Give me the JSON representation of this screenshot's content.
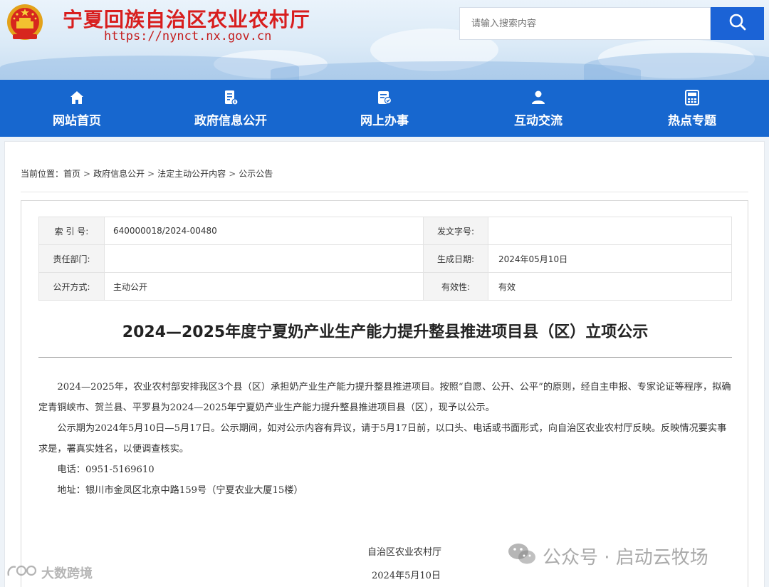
{
  "header": {
    "site_title": "宁夏回族自治区农业农村厅",
    "site_url": "https://nynct.nx.gov.cn",
    "search_placeholder": "请输入搜索内容",
    "emblem_icon": "national-emblem-icon",
    "search_icon": "search-icon",
    "brand_color": "#d81e1e"
  },
  "nav": {
    "color": "#1767cf",
    "items": [
      {
        "label": "网站首页",
        "icon": "home-icon"
      },
      {
        "label": "政府信息公开",
        "icon": "document-info-icon"
      },
      {
        "label": "网上办事",
        "icon": "service-icon"
      },
      {
        "label": "互动交流",
        "icon": "users-icon"
      },
      {
        "label": "热点专题",
        "icon": "calculator-icon"
      }
    ]
  },
  "breadcrumb": {
    "prefix": "当前位置：",
    "items": [
      "首页",
      "政府信息公开",
      "法定主动公开内容",
      "公示公告"
    ],
    "separator": ">"
  },
  "meta": {
    "index_label": "索 引 号:",
    "index_value": "640000018/2024-00480",
    "doc_no_label": "发文字号:",
    "doc_no_value": "",
    "dept_label": "责任部门:",
    "dept_value": "",
    "date_label": "生成日期:",
    "date_value": "2024年05月10日",
    "public_label": "公开方式:",
    "public_value": "主动公开",
    "validity_label": "有效性:",
    "validity_value": "有效"
  },
  "article": {
    "title": "2024—2025年度宁夏奶产业生产能力提升整县推进项目县（区）立项公示",
    "paragraphs": [
      "2024—2025年，农业农村部安排我区3个县（区）承担奶产业生产能力提升整县推进项目。按照“自愿、公开、公平”的原则，经自主申报、专家论证等程序，拟确定青铜峡市、贺兰县、平罗县为2024—2025年宁夏奶产业生产能力提升整县推进项目县（区），现予以公示。",
      "公示期为2024年5月10日—5月17日。公示期间，如对公示内容有异议，请于5月17日前，以口头、电话或书面形式，向自治区农业农村厅反映。反映情况要实事求是，署真实姓名，以便调查核实。",
      "电话：0951-5169610",
      "地址：银川市金凤区北京中路159号（宁夏农业大厦15楼）"
    ],
    "signature": "自治区农业农村厅",
    "signature_date": "2024年5月10日"
  },
  "watermarks": {
    "right": "公众号 · 启动云牧场",
    "right_icon": "wechat-icon",
    "left": "大数跨境",
    "left_icon": "brand-logo-icon"
  }
}
